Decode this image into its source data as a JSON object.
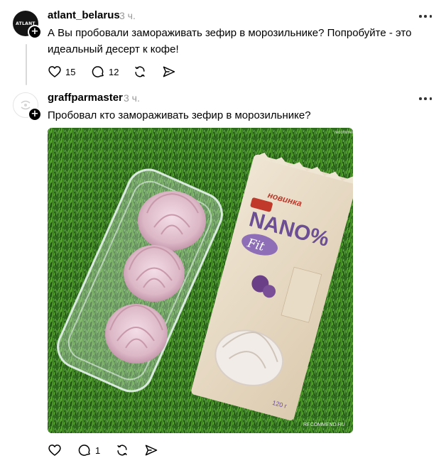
{
  "posts": [
    {
      "username": "atlant_belarus",
      "time": "3 ч.",
      "avatar_text": "ATLANT",
      "text": "А Вы пробовали замораживать зефир в морозильнике? Попробуйте - это идеальный десерт к кофе!",
      "likes": "15",
      "comments": "12"
    },
    {
      "username": "graffparmaster",
      "time": "3 ч.",
      "text": "Пробовал кто замораживать зефир в морозильнике?",
      "likes": "",
      "comments": "1"
    }
  ],
  "photo": {
    "package_new": "новинка",
    "package_brand": "NANO%",
    "package_sub": "Fit",
    "package_weight": "120 г",
    "watermark": "RECOMMEND.RU",
    "corner_mark": "recommend"
  },
  "icons": {
    "like": "heart-icon",
    "comment": "comment-bubble-icon",
    "repost": "repost-icon",
    "share": "share-paper-plane-icon",
    "more": "more-dots-icon"
  }
}
